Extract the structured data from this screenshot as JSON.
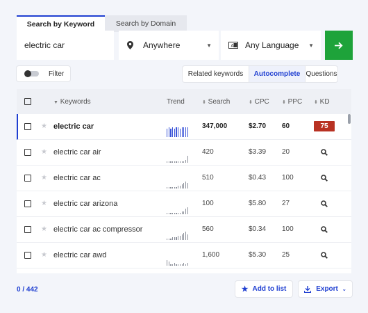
{
  "tabs": [
    {
      "label": "Search by Keyword",
      "active": true
    },
    {
      "label": "Search by Domain",
      "active": false
    }
  ],
  "search": {
    "keyword": "electric car",
    "location": "Anywhere",
    "language": "Any Language"
  },
  "toolbar": {
    "filter_label": "Filter",
    "modes": [
      "Related keywords",
      "Autocomplete",
      "Questions"
    ],
    "active_mode": "Autocomplete"
  },
  "table": {
    "headers": {
      "keywords": "Keywords",
      "trend": "Trend",
      "search": "Search",
      "cpc": "CPC",
      "ppc": "PPC",
      "kd": "KD"
    },
    "rows": [
      {
        "keyword": "electric car",
        "search": "347,000",
        "cpc": "$2.70",
        "ppc": "60",
        "kd": "75",
        "trend": [
          6,
          7,
          6,
          7,
          6,
          7,
          7,
          6,
          7,
          7,
          7,
          7
        ]
      },
      {
        "keyword": "electric car air",
        "search": "420",
        "cpc": "$3.39",
        "ppc": "20",
        "kd": "",
        "trend": [
          1,
          1,
          1,
          1,
          1,
          1,
          1,
          1,
          1,
          1,
          2,
          5
        ]
      },
      {
        "keyword": "electric car ac",
        "search": "510",
        "cpc": "$0.43",
        "ppc": "100",
        "kd": "",
        "trend": [
          1,
          1,
          1,
          1,
          1,
          1,
          2,
          2,
          3,
          4,
          5,
          4
        ]
      },
      {
        "keyword": "electric car arizona",
        "search": "100",
        "cpc": "$5.80",
        "ppc": "27",
        "kd": "",
        "trend": [
          1,
          1,
          1,
          1,
          1,
          1,
          1,
          1,
          2,
          2,
          4,
          5
        ]
      },
      {
        "keyword": "electric car ac compressor",
        "search": "560",
        "cpc": "$0.34",
        "ppc": "100",
        "kd": "",
        "trend": [
          1,
          1,
          1,
          2,
          2,
          2,
          3,
          3,
          4,
          5,
          6,
          4
        ]
      },
      {
        "keyword": "electric car awd",
        "search": "1,600",
        "cpc": "$5.30",
        "ppc": "25",
        "kd": "",
        "trend": [
          4,
          3,
          1,
          1,
          2,
          1,
          1,
          1,
          1,
          2,
          1,
          2
        ]
      }
    ]
  },
  "footer": {
    "count": "0 / 442",
    "add_label": "Add to list",
    "export_label": "Export"
  },
  "colors": {
    "accent": "#1f3fd1",
    "go_button": "#1ea33a",
    "kd_high": "#b83223"
  }
}
